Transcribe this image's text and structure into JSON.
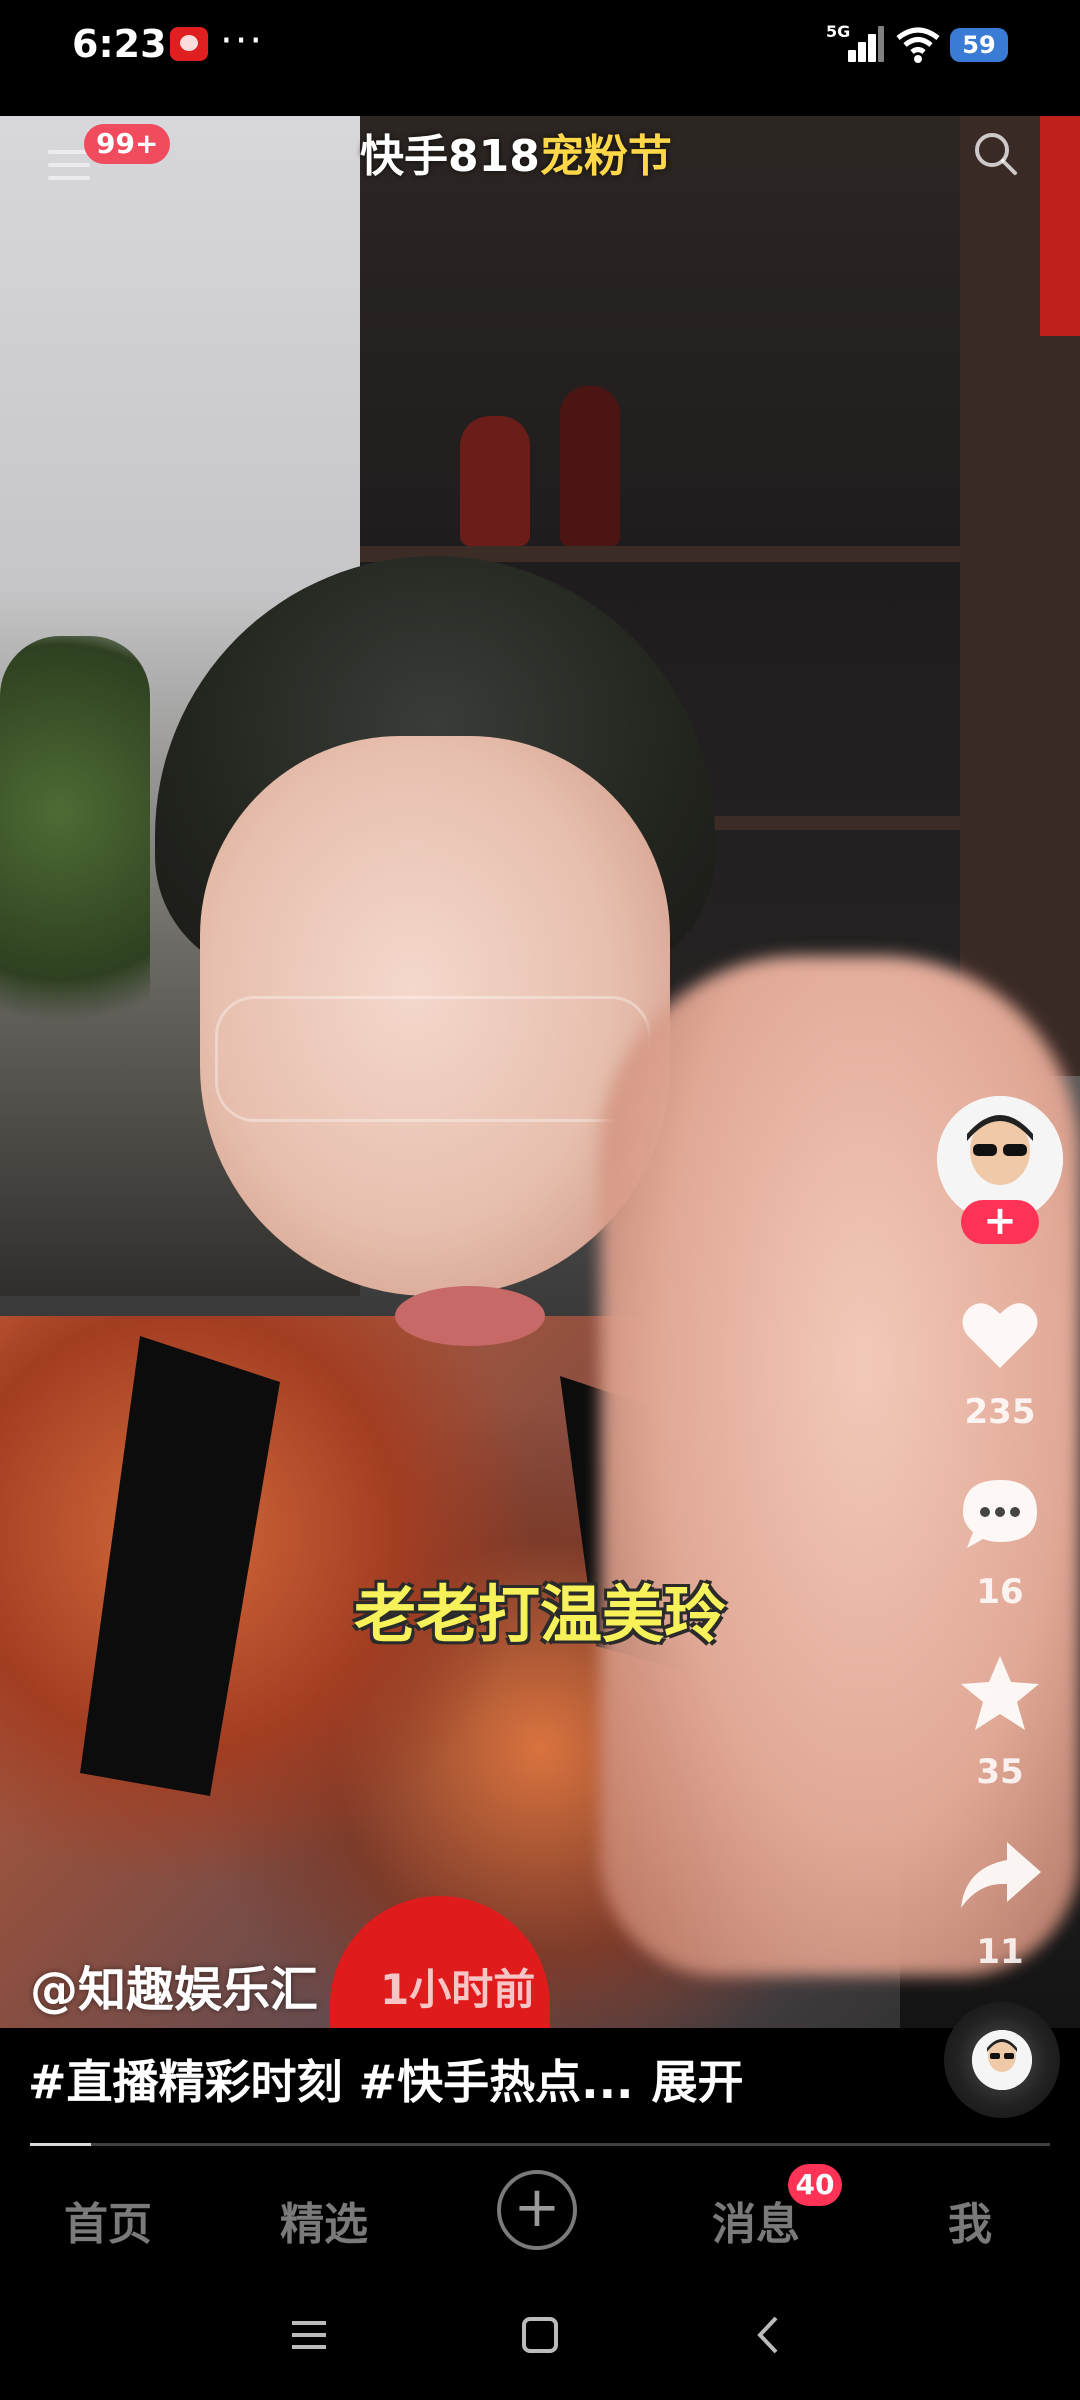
{
  "status_bar": {
    "time": "6:23",
    "more": "···",
    "network": "5G",
    "battery": "59"
  },
  "video": {
    "banner_prefix": "快手",
    "banner_highlight": "818",
    "banner_suffix": "宠粉节",
    "notification_badge": "99+",
    "subtitle": "老老打温美玲",
    "progress_fraction": 0.06
  },
  "rail": {
    "follow_label": "+",
    "likes": "235",
    "comments": "16",
    "favorites": "35",
    "shares": "11"
  },
  "post": {
    "author": "@知趣娱乐汇",
    "time_ago": "1小时前",
    "description": "#直播精彩时刻 #快手热点...",
    "expand_label": "展开"
  },
  "nav": {
    "home": "首页",
    "featured": "精选",
    "add": "+",
    "messages": "消息",
    "messages_badge": "40",
    "me": "我"
  },
  "colors": {
    "accent_red": "#fe3355",
    "subtitle_yellow": "#f7f25a",
    "battery_blue": "#3a7bd5"
  },
  "icons": {
    "menu": "menu-icon",
    "search": "search-icon",
    "like": "heart-icon",
    "comment": "comment-icon",
    "favorite": "star-icon",
    "share": "share-icon"
  }
}
